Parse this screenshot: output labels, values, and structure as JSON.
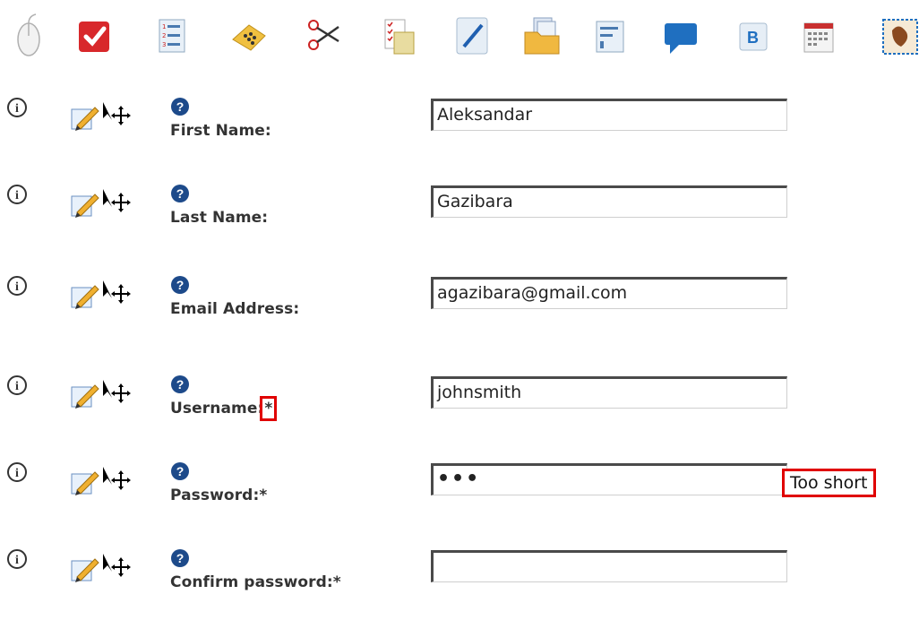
{
  "toolbar": {
    "icons": [
      {
        "name": "mouse-icon"
      },
      {
        "name": "checkbox-icon"
      },
      {
        "name": "numbered-list-icon"
      },
      {
        "name": "dotted-tag-icon"
      },
      {
        "name": "scissors-icon"
      },
      {
        "name": "checklist-icon"
      },
      {
        "name": "pencil-note-icon"
      },
      {
        "name": "folder-files-icon"
      },
      {
        "name": "document-icon"
      },
      {
        "name": "speech-bubble-icon"
      },
      {
        "name": "bold-b-icon"
      },
      {
        "name": "calendar-icon"
      },
      {
        "name": "stamp-icon"
      }
    ]
  },
  "form": {
    "first_name": {
      "label": "First Name:",
      "required_mark": "",
      "value": ""
    },
    "last_name": {
      "label": "Last Name:",
      "required_mark": "",
      "value": "Gazibara"
    },
    "email": {
      "label": "Email Address:",
      "required_mark": "",
      "value": "agazibara@gmail.com"
    },
    "username": {
      "label": "Username:",
      "required_mark": "*",
      "value": "johnsmith"
    },
    "password": {
      "label": "Password:*",
      "required_mark": "",
      "value": "•••",
      "validation": "Too short"
    },
    "confirm_password": {
      "label": "Confirm password:*",
      "required_mark": "",
      "value": ""
    }
  },
  "first_name_value": "Aleksandar",
  "colors": {
    "accent_red": "#e00000",
    "info_dark": "#333333",
    "help_blue": "#1d4a8a"
  }
}
